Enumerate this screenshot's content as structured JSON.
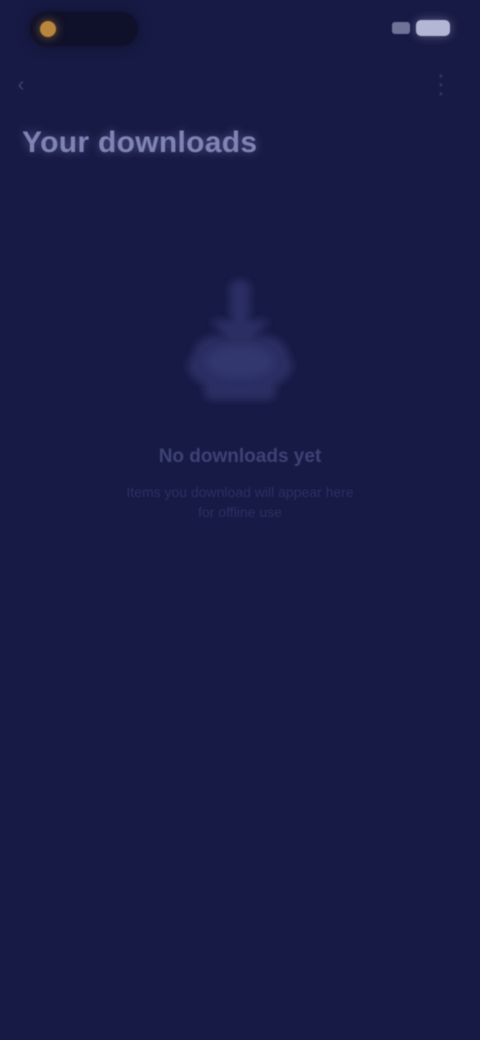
{
  "status_bar": {
    "time": "",
    "battery": ""
  },
  "header": {
    "back_icon": "chevron-left-icon",
    "more_icon": "more-vertical-icon",
    "title": "Your downloads"
  },
  "empty_state": {
    "icon": "download-cloud-icon",
    "title": "No downloads yet",
    "subtitle": "Items you download will appear here for offline use"
  },
  "colors": {
    "background": "#171a44",
    "title_text": "#7f84b4",
    "muted_text": "#3d4276",
    "recording_dot": "#b8863c"
  }
}
